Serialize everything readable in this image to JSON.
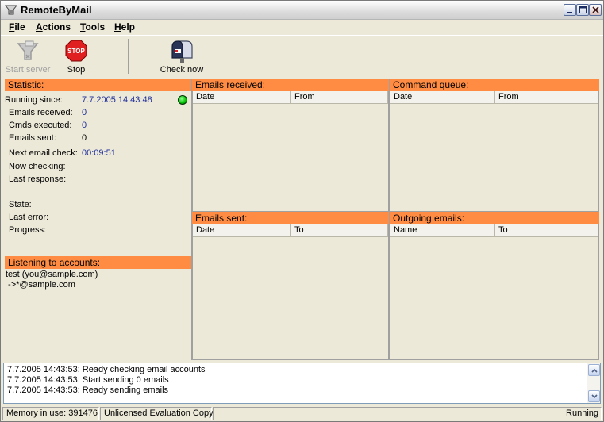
{
  "window": {
    "title": "RemoteByMail"
  },
  "menu": [
    {
      "first": "F",
      "rest": "ile"
    },
    {
      "first": "A",
      "rest": "ctions"
    },
    {
      "first": "T",
      "rest": "ools"
    },
    {
      "first": "H",
      "rest": "elp"
    }
  ],
  "toolbar": {
    "start_server": "Start server",
    "stop": "Stop",
    "stop_sign_text": "STOP",
    "check_now": "Check now"
  },
  "statistic": {
    "header": "Statistic:",
    "running_since_label": "Running since:",
    "running_since_value": "7.7.2005 14:43:48",
    "emails_received_label": "Emails received:",
    "emails_received_value": "0",
    "cmds_executed_label": "Cmds executed:",
    "cmds_executed_value": "0",
    "emails_sent_label": "Emails sent:",
    "emails_sent_value": "0",
    "next_check_label": "Next email check:",
    "next_check_value": "00:09:51",
    "now_checking_label": "Now checking:",
    "last_response_label": "Last response:",
    "state_label": "State:",
    "last_error_label": "Last error:",
    "progress_label": "Progress:"
  },
  "accounts": {
    "header": "Listening to accounts:",
    "items": [
      "test (you@sample.com)",
      " ->*@sample.com"
    ]
  },
  "emails_received": {
    "header": "Emails received:",
    "columns": [
      "Date",
      "From"
    ]
  },
  "command_queue": {
    "header": "Command queue:",
    "columns": [
      "Date",
      "From"
    ]
  },
  "emails_sent": {
    "header": "Emails sent:",
    "columns": [
      "Date",
      "To"
    ]
  },
  "outgoing_emails": {
    "header": "Outgoing emails:",
    "columns": [
      "Name",
      "To"
    ]
  },
  "log": [
    "7.7.2005 14:43:53: Ready checking email accounts",
    "7.7.2005 14:43:53: Start sending 0 emails",
    "7.7.2005 14:43:53: Ready sending emails"
  ],
  "statusbar": {
    "memory": "Memory in use: 391476",
    "license": "Unlicensed Evaluation Copy",
    "state": "Running"
  },
  "colors": {
    "header_orange": "#ff8c42",
    "value_blue": "#1f2f9a",
    "status_green": "#00c000"
  }
}
